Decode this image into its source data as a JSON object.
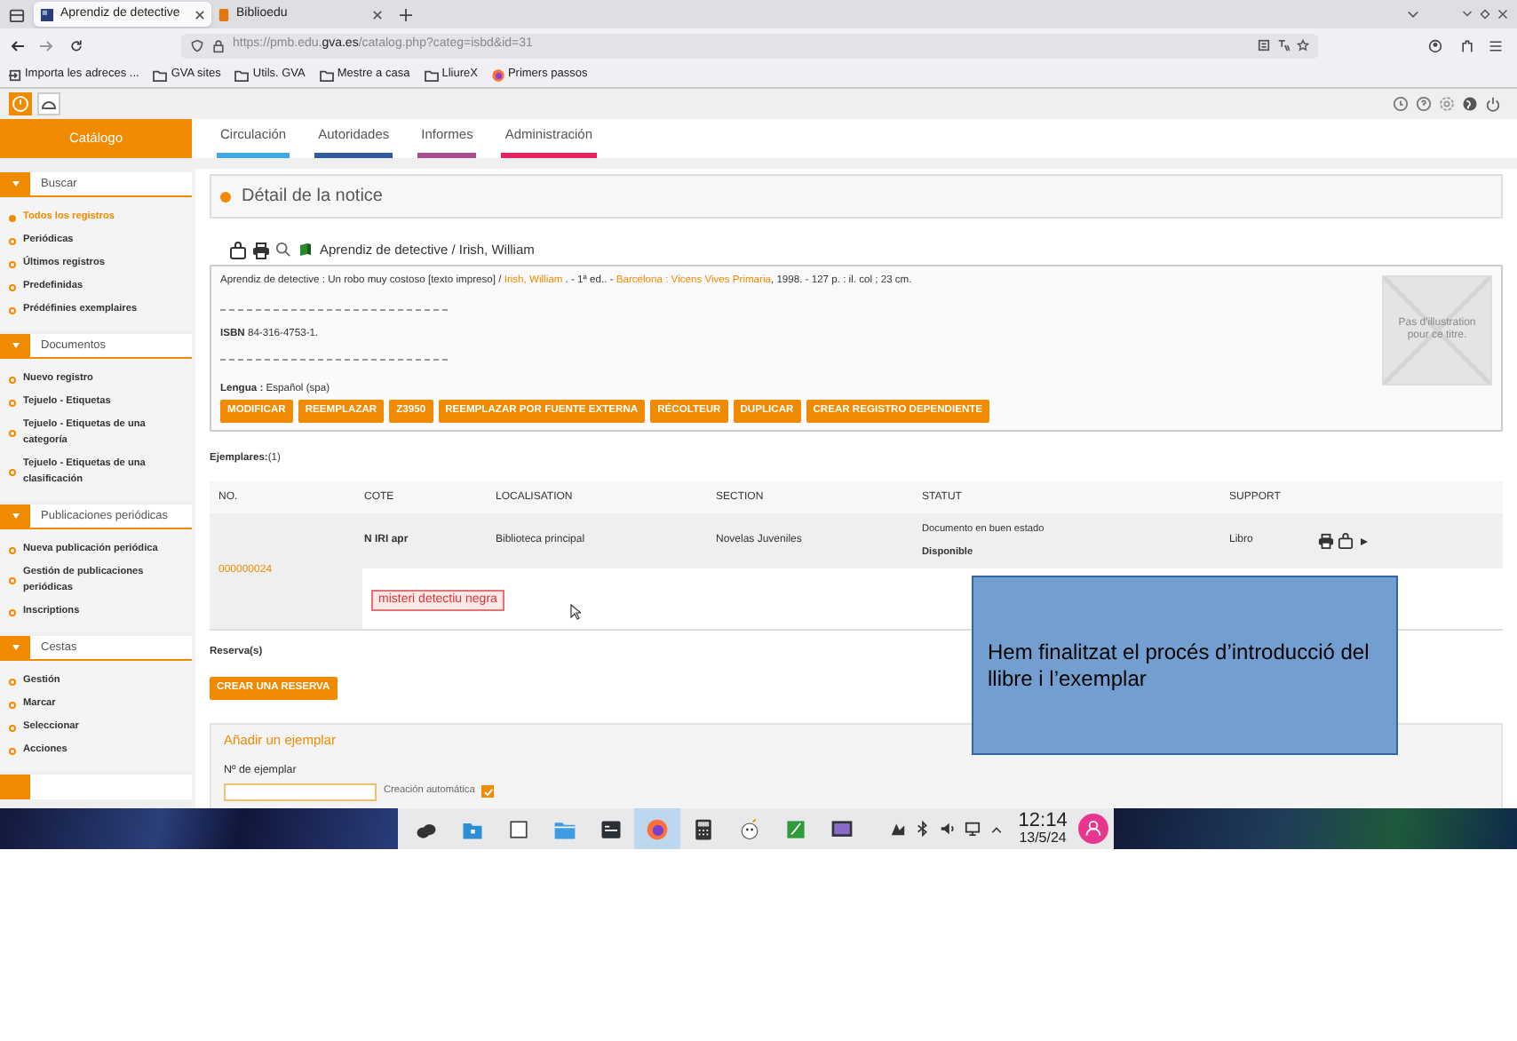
{
  "browser": {
    "tabs": [
      {
        "label": "Aprendiz de detective",
        "selected": true
      },
      {
        "label": "Biblioedu",
        "selected": false
      }
    ],
    "url": {
      "prefix": "https://pmb.edu.",
      "host": "gva.es",
      "path": "/catalog.php?categ=isbd&id=31"
    },
    "bookmarks": [
      {
        "label": "Importa les adreces ...",
        "kind": "import"
      },
      {
        "label": "GVA sites",
        "kind": "folder"
      },
      {
        "label": "Utils. GVA",
        "kind": "folder"
      },
      {
        "label": "Mestre a casa",
        "kind": "folder"
      },
      {
        "label": "LliureX",
        "kind": "folder"
      },
      {
        "label": "Primers passos",
        "kind": "firefox"
      }
    ]
  },
  "app": {
    "module": "Catálogo",
    "nav": [
      {
        "label": "Circulación",
        "color": "#3ea8e5"
      },
      {
        "label": "Autoridades",
        "color": "#2f5a9c"
      },
      {
        "label": "Informes",
        "color": "#a64d8f"
      },
      {
        "label": "Administración",
        "color": "#e3245f"
      }
    ],
    "sidebar": [
      {
        "title": "Buscar",
        "items": [
          {
            "label": "Todos los registros",
            "selected": true
          },
          {
            "label": "Periódicas",
            "selected": false
          },
          {
            "label": "Últimos registros",
            "selected": false
          },
          {
            "label": "Predefinidas",
            "selected": false
          },
          {
            "label": "Prédéfinies exemplaires",
            "selected": false
          }
        ]
      },
      {
        "title": "Documentos",
        "items": [
          {
            "label": "Nuevo registro",
            "selected": false
          },
          {
            "label": "Tejuelo - Etiquetas",
            "selected": false
          },
          {
            "label": "Tejuelo - Etiquetas de una categoría",
            "selected": false
          },
          {
            "label": "Tejuelo - Etiquetas de una clasificación",
            "selected": false
          }
        ]
      },
      {
        "title": "Publicaciones periódicas",
        "items": [
          {
            "label": "Nueva publicación periódica",
            "selected": false
          },
          {
            "label": "Gestión de publicaciones periódicas",
            "selected": false
          },
          {
            "label": "Inscriptions",
            "selected": false
          }
        ]
      },
      {
        "title": "Cestas",
        "items": [
          {
            "label": "Gestión",
            "selected": false
          },
          {
            "label": "Marcar",
            "selected": false
          },
          {
            "label": "Seleccionar",
            "selected": false
          },
          {
            "label": "Acciones",
            "selected": false
          }
        ]
      }
    ],
    "notice": {
      "title": "Détail de la notice",
      "heading": "Aprendiz de detective / Irish, William",
      "description": [
        {
          "text": "Aprendiz de detective : Un robo muy costoso [texto impreso] / ",
          "link": false
        },
        {
          "text": "Irish, William",
          "link": true
        },
        {
          "text": " . - 1ª ed.. - ",
          "link": false
        },
        {
          "text": "Barcelona : Vicens Vives Primaria",
          "link": true
        },
        {
          "text": ", 1998. - 127 p. : il. col ; 23 cm.",
          "link": false
        }
      ],
      "isbn_label": "ISBN",
      "isbn": "84-316-4753-1.",
      "language_label": "Lengua :",
      "language": "Español (spa)",
      "thumbnail_text": "Pas d'illustration pour ce titre.",
      "buttons": [
        "MODIFICAR",
        "REEMPLAZAR",
        "Z3950",
        "REEMPLAZAR POR FUENTE EXTERNA",
        "RÉCOLTEUR",
        "DUPLICAR",
        "CREAR REGISTRO DEPENDIENTE"
      ]
    },
    "copies": {
      "label": "Ejemplares:",
      "count": "(1)",
      "columns": [
        "NO.",
        "COTE",
        "LOCALISATION",
        "SECTION",
        "STATUT",
        "SUPPORT"
      ],
      "rows": [
        {
          "number": "000000024",
          "cote": "N IRI apr",
          "location": "Biblioteca principal",
          "section": "Novelas Juveniles",
          "status": "Documento en buen estado",
          "availability": "Disponible",
          "support": "Libro",
          "note": "misteri detectiu negra"
        }
      ]
    },
    "reservations": {
      "label": "Reserva(s)",
      "button": "CREAR UNA RESERVA"
    },
    "add_copy": {
      "title": "Añadir un ejemplar",
      "field_label": "Nº de ejemplar",
      "auto_label": "Creación automática",
      "auto_checked": true
    }
  },
  "callout": {
    "text": "Hem finalitzat el procés d’introducció del llibre i l’exemplar"
  },
  "taskbar": {
    "apps": [
      {
        "kind": "blob",
        "selected": false
      },
      {
        "kind": "folder-home",
        "selected": false
      },
      {
        "kind": "window",
        "selected": false
      },
      {
        "kind": "folder",
        "selected": false
      },
      {
        "kind": "terminal",
        "selected": false
      },
      {
        "kind": "firefox",
        "selected": true
      },
      {
        "kind": "calculator",
        "selected": false
      },
      {
        "kind": "face",
        "selected": false
      },
      {
        "kind": "green",
        "selected": false
      },
      {
        "kind": "monitor",
        "selected": false
      }
    ],
    "time": "12:14",
    "date": "13/5/24"
  }
}
